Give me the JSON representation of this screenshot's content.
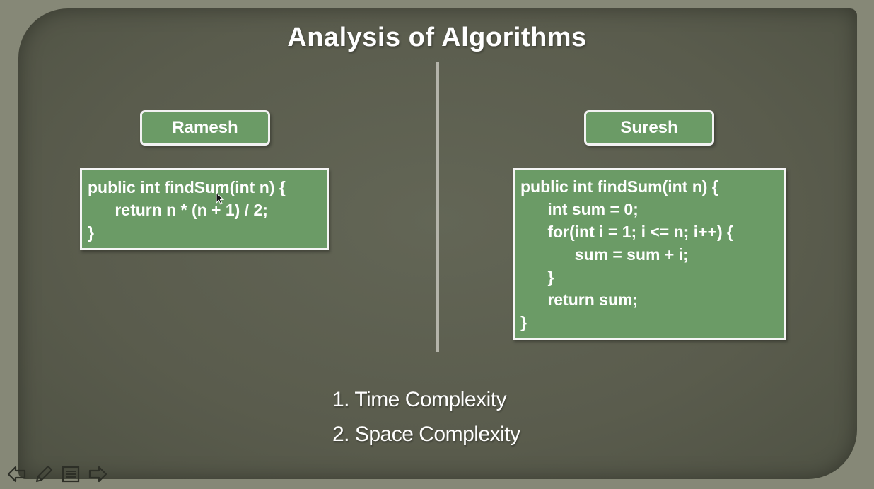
{
  "slide": {
    "title": "Analysis of Algorithms",
    "left": {
      "name": "Ramesh",
      "code": [
        "public int findSum(int n) {",
        "      return n * (n + 1) / 2;",
        "}"
      ]
    },
    "right": {
      "name": "Suresh",
      "code": [
        "public int findSum(int n) {",
        "      int sum = 0;",
        "      for(int i = 1; i <= n; i++) {",
        "            sum = sum + i;",
        "      }",
        "      return sum;",
        "}"
      ]
    },
    "complexities": [
      "1. Time Complexity",
      "2. Space Complexity"
    ]
  },
  "toolbar": {
    "icons": [
      "previous-slide-icon",
      "pen-icon",
      "menu-icon",
      "next-slide-icon"
    ]
  },
  "colors": {
    "board": "#5a5c4d",
    "box_fill": "#6b9b66",
    "box_border": "#f2f2f2",
    "text": "#ffffff"
  }
}
